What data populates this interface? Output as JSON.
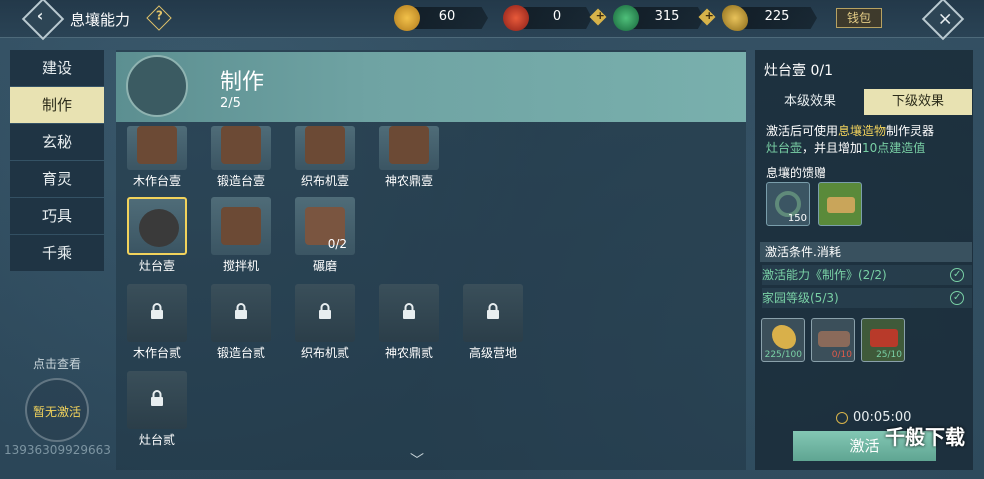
{
  "header": {
    "title": "息壤能力",
    "help_label": "?",
    "wallet_label": "钱包",
    "resources": [
      {
        "name": "coin",
        "value": "60"
      },
      {
        "name": "red-orb",
        "value": "0"
      },
      {
        "name": "green-jade",
        "value": "315"
      },
      {
        "name": "gold-leaf",
        "value": "225"
      }
    ],
    "plus_label": "+"
  },
  "leftnav": {
    "items": [
      {
        "label": "建设"
      },
      {
        "label": "制作"
      },
      {
        "label": "玄秘"
      },
      {
        "label": "育灵"
      },
      {
        "label": "巧具"
      },
      {
        "label": "千乘"
      }
    ],
    "click_view": "点击查看",
    "inactive": "暂无激活"
  },
  "uid": "13936309929663",
  "center": {
    "title": "制作",
    "count": "2/5",
    "rows": [
      [
        "木作台壹",
        "锻造台壹",
        "织布机壹",
        "神农鼎壹"
      ],
      [
        "灶台壹",
        "搅拌机",
        "碾磨"
      ],
      [
        "木作台贰",
        "锻造台贰",
        "织布机贰",
        "神农鼎贰",
        "高级营地"
      ],
      [
        "灶台贰"
      ]
    ],
    "mill_progress": "0/2"
  },
  "right": {
    "title": "灶台壹 0/1",
    "tabs": [
      "本级效果",
      "下级效果"
    ],
    "desc_1": "激活后可使用",
    "desc_hl1": "息壤造物",
    "desc_2": "制作灵器",
    "desc_hl2": "灶台壶",
    "desc_3": "，并且增加",
    "desc_hl3": "10点建造值",
    "gift_title": "息壤的馈赠",
    "gift_count": "150",
    "cond_header": "激活条件.消耗",
    "conditions": [
      "激活能力《制作》(2/2)",
      "家园等级(5/3)"
    ],
    "costs": [
      {
        "count": "225/100",
        "color": "#79d0a5"
      },
      {
        "count": "0/10",
        "color": "#e05a4a"
      },
      {
        "count": "25/10",
        "color": "#79d0a5"
      }
    ],
    "timer": "00:05:00",
    "activate_label": "激活"
  },
  "watermark": "千般下载"
}
